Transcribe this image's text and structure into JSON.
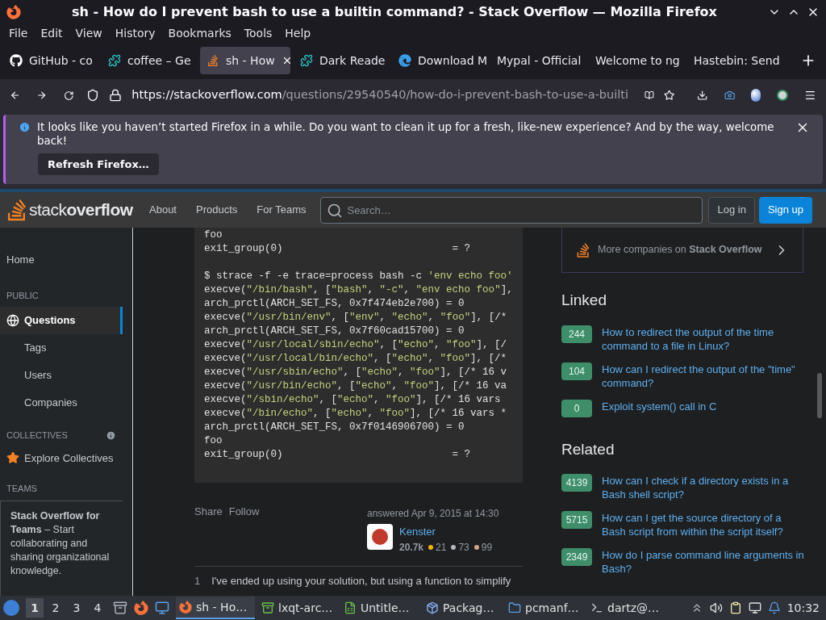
{
  "window": {
    "title": "sh - How do I prevent bash to use a builtin command? - Stack Overflow — Mozilla Firefox"
  },
  "menu": [
    "File",
    "Edit",
    "View",
    "History",
    "Bookmarks",
    "Tools",
    "Help"
  ],
  "tabs": [
    {
      "label": "GitHub - co",
      "kind": "github",
      "selected": false
    },
    {
      "label": "coffee – Ge",
      "kind": "extension",
      "selected": false
    },
    {
      "label": "sh - How",
      "kind": "stackoverflow",
      "selected": true
    },
    {
      "label": "Dark Reade",
      "kind": "extension",
      "selected": false
    },
    {
      "label": "Download M",
      "kind": "edge",
      "selected": false
    },
    {
      "label": "Mypal - Official",
      "kind": "plain",
      "selected": false
    },
    {
      "label": "Welcome to ng",
      "kind": "plain",
      "selected": false
    },
    {
      "label": "Hastebin: Send",
      "kind": "plain",
      "selected": false
    }
  ],
  "address": {
    "host": "https://stackoverflow.com",
    "path": "/questions/29540540/how-do-i-prevent-bash-to-use-a-builti"
  },
  "notification": {
    "message": "It looks like you haven’t started Firefox in a while. Do you want to clean it up for a fresh, like-new experience? And by the way, welcome back!",
    "button": "Refresh Firefox…"
  },
  "site_header": {
    "logo": "stack**overflow**",
    "nav": [
      "About",
      "Products",
      "For Teams"
    ],
    "search_placeholder": "Search…",
    "login": "Log in",
    "signup": "Sign up"
  },
  "sidebar": {
    "home": {
      "label": "Home",
      "selected": false
    },
    "public": {
      "heading": "PUBLIC",
      "items": [
        {
          "label": "Questions",
          "selected": true
        },
        {
          "label": "Tags",
          "selected": false
        },
        {
          "label": "Users",
          "selected": false
        },
        {
          "label": "Companies",
          "selected": false
        }
      ]
    },
    "collectives": {
      "heading": "COLLECTIVES",
      "link": "Explore Collectives"
    },
    "teams": {
      "heading": "TEAMS",
      "promo": "**Stack Overflow for Teams** – Start collaborating and sharing organizational knowledge."
    }
  },
  "answer": {
    "code": [
      [
        "foo",
        "exit_group(0)                            = ?"
      ],
      [
        "$ strace -f -e trace=process bash -c 'env echo foo'",
        "execve(\"/bin/bash\", [\"bash\", \"-c\", \"env echo foo\"],",
        "arch_prctl(ARCH_SET_FS, 0x7f474eb2e700) = 0",
        "execve(\"/usr/bin/env\", [\"env\", \"echo\", \"foo\"], [/*",
        "arch_prctl(ARCH_SET_FS, 0x7f60cad15700) = 0",
        "execve(\"/usr/local/sbin/echo\", [\"echo\", \"foo\"], [/",
        "execve(\"/usr/local/bin/echo\", [\"echo\", \"foo\"], [/*",
        "execve(\"/usr/sbin/echo\", [\"echo\", \"foo\"], [/* 16 v",
        "execve(\"/usr/bin/echo\", [\"echo\", \"foo\"], [/* 16 va",
        "execve(\"/sbin/echo\", [\"echo\", \"foo\"], [/* 16 vars",
        "execve(\"/bin/echo\", [\"echo\", \"foo\"], [/* 16 vars *",
        "arch_prctl(ARCH_SET_FS, 0x7f0146906700) = 0",
        "foo",
        "exit_group(0)                            = ?"
      ]
    ],
    "actions": [
      "Share",
      "Follow"
    ],
    "answered": "answered Apr 9, 2015 at 14:30",
    "user": {
      "name": "Kenster",
      "reputation": "20.7k",
      "badges": [
        {
          "count": "21",
          "color": "#f1b600"
        },
        {
          "count": "73",
          "color": "#b4b8bc"
        },
        {
          "count": "99",
          "color": "#d1a684"
        }
      ]
    },
    "comments": [
      {
        "score": "1",
        "text": "I've ended up using your solution, but using a function to simplify"
      }
    ]
  },
  "companies": "More companies on **Stack Overflow**",
  "linked": {
    "title": "Linked",
    "items": [
      {
        "score": "244",
        "title": "How to redirect the output of the time command to a file in Linux?"
      },
      {
        "score": "104",
        "title": "How can I redirect the output of the \"time\" command?"
      },
      {
        "score": "0",
        "title": "Exploit system() call in C"
      }
    ]
  },
  "related": {
    "title": "Related",
    "items": [
      {
        "score": "4139",
        "title": "How can I check if a directory exists in a Bash shell script?"
      },
      {
        "score": "5715",
        "title": "How can I get the source directory of a Bash script from within the script itself?"
      },
      {
        "score": "2349",
        "title": "How do I parse command line arguments in Bash?"
      }
    ]
  },
  "taskbar": {
    "desktops": [
      {
        "label": "1",
        "selected": true
      },
      {
        "label": "2",
        "selected": false
      },
      {
        "label": "3",
        "selected": false
      },
      {
        "label": "4",
        "selected": false
      }
    ],
    "tasks": [
      {
        "label": "sh - Ho…",
        "kind": "firefox",
        "selected": true
      },
      {
        "label": "lxqt-arc…",
        "kind": "archive",
        "selected": false
      },
      {
        "label": "Untitle…",
        "kind": "sheet",
        "selected": false
      },
      {
        "label": "Packag…",
        "kind": "package",
        "selected": false
      },
      {
        "label": "pcmanf…",
        "kind": "folder",
        "selected": false
      },
      {
        "label": "dartz@…",
        "kind": "terminal",
        "selected": false
      }
    ],
    "clock": "10:32"
  }
}
